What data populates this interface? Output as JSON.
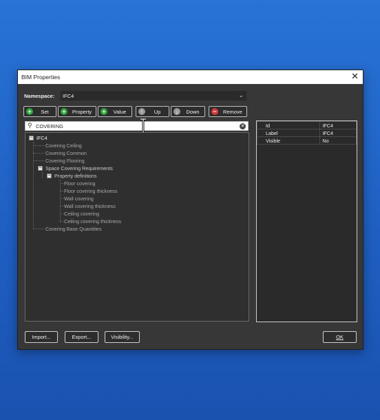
{
  "window": {
    "title": "BIM Properties"
  },
  "namespace": {
    "label": "Namespace:",
    "value": "IFC4"
  },
  "toolbar": {
    "set": "Set",
    "property": "Property",
    "value": "Value",
    "up": "Up",
    "down": "Down",
    "remove": "Remove"
  },
  "search": {
    "value": "COVERING"
  },
  "tree": {
    "root": "IFC4",
    "covering_ceiling": "Covering Ceiling",
    "covering_common": "Covering Common",
    "covering_flooring": "Covering Flooring",
    "space_req": "Space Covering Requirements",
    "prop_defs": "Property definitions",
    "floor_covering": "Floor covering",
    "floor_covering_thickness": "Floor covering thickness",
    "wall_covering": "Wall covering",
    "wall_covering_thickness": "Wall covering thickness",
    "ceiling_covering": "Ceiling covering",
    "ceiling_covering_thickness": "Ceiling covering thickness",
    "base_quantities": "Covering Base Quantities"
  },
  "properties": {
    "rows": [
      {
        "name": "Id",
        "value": "IFC4"
      },
      {
        "name": "Label",
        "value": "IFC4"
      },
      {
        "name": "Visible",
        "value": "No"
      }
    ]
  },
  "footer": {
    "import": "Import...",
    "export": "Export...",
    "visibility": "Visibility...",
    "ok": "OK"
  }
}
